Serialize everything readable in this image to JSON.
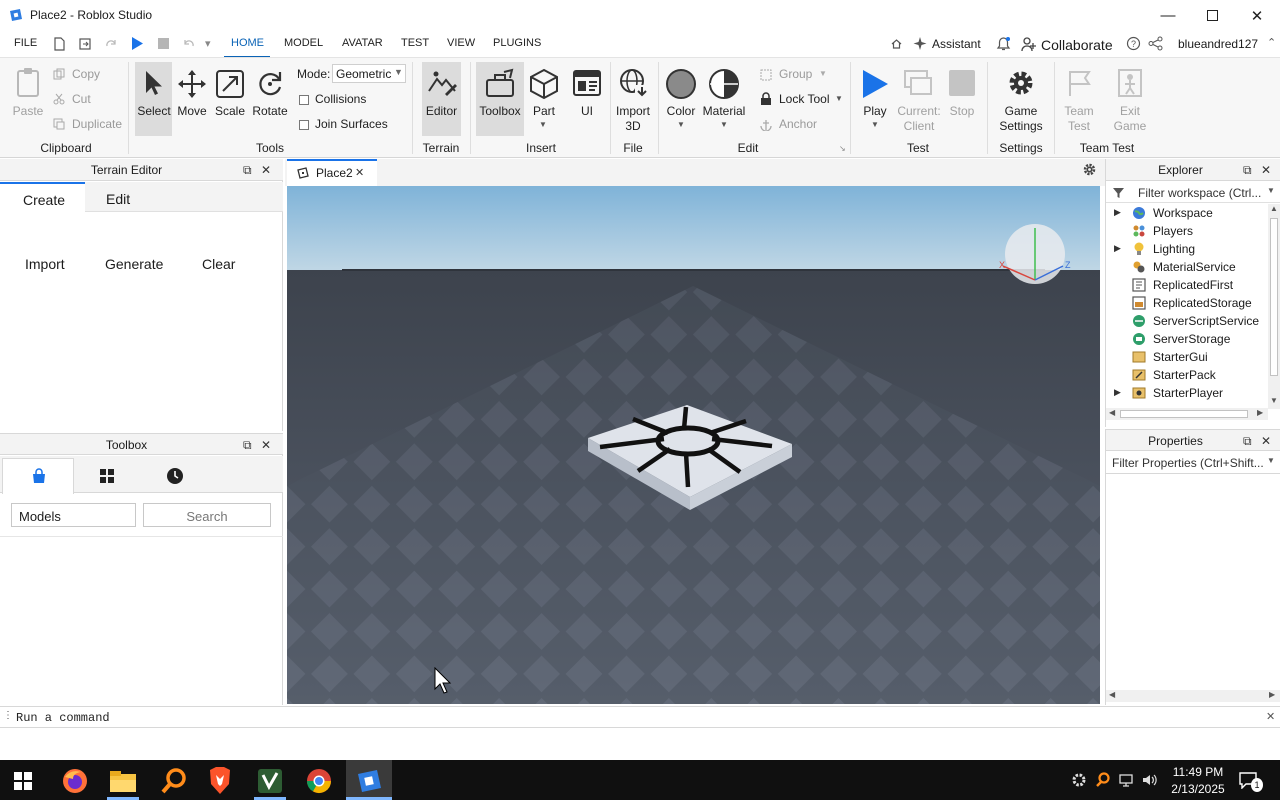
{
  "window": {
    "title": "Place2 - Roblox Studio"
  },
  "menu": {
    "file": "FILE",
    "tabs": [
      "HOME",
      "MODEL",
      "AVATAR",
      "TEST",
      "VIEW",
      "PLUGINS"
    ],
    "assistant": "Assistant",
    "collaborate": "Collaborate",
    "username": "blueandred127"
  },
  "ribbon": {
    "clipboard": {
      "paste": "Paste",
      "copy": "Copy",
      "cut": "Cut",
      "duplicate": "Duplicate",
      "label": "Clipboard"
    },
    "tools": {
      "select": "Select",
      "move": "Move",
      "scale": "Scale",
      "rotate": "Rotate",
      "mode_label": "Mode:",
      "mode_value": "Geometric",
      "collisions": "Collisions",
      "join_surfaces": "Join Surfaces",
      "label": "Tools"
    },
    "terrain": {
      "editor": "Editor",
      "label": "Terrain"
    },
    "insert": {
      "toolbox": "Toolbox",
      "part": "Part",
      "ui": "UI",
      "label": "Insert"
    },
    "file": {
      "import_line1": "Import",
      "import_line2": "3D",
      "label": "File"
    },
    "edit": {
      "color": "Color",
      "material": "Material",
      "group": "Group",
      "lock_tool": "Lock Tool",
      "anchor": "Anchor",
      "label": "Edit"
    },
    "test": {
      "play": "Play",
      "current_line1": "Current:",
      "current_line2": "Client",
      "stop": "Stop",
      "label": "Test"
    },
    "settings": {
      "game_line1": "Game",
      "game_line2": "Settings",
      "label": "Settings"
    },
    "team_test": {
      "team_line1": "Team",
      "team_line2": "Test",
      "exit_line1": "Exit",
      "exit_line2": "Game",
      "label": "Team Test"
    }
  },
  "terrain_editor": {
    "title": "Terrain Editor",
    "tabs": {
      "create": "Create",
      "edit": "Edit"
    },
    "actions": {
      "import": "Import",
      "generate": "Generate",
      "clear": "Clear"
    }
  },
  "toolbox": {
    "title": "Toolbox",
    "category": "Models",
    "search_placeholder": "Search"
  },
  "viewport_tab": {
    "label": "Place2"
  },
  "explorer": {
    "title": "Explorer",
    "filter_placeholder": "Filter workspace (Ctrl...",
    "items": [
      "Workspace",
      "Players",
      "Lighting",
      "MaterialService",
      "ReplicatedFirst",
      "ReplicatedStorage",
      "ServerScriptService",
      "ServerStorage",
      "StarterGui",
      "StarterPack",
      "StarterPlayer"
    ]
  },
  "properties": {
    "title": "Properties",
    "filter_placeholder": "Filter Properties (Ctrl+Shift..."
  },
  "command_bar": {
    "placeholder": "Run a command"
  },
  "taskbar": {
    "time": "11:49 PM",
    "date": "2/13/2025",
    "notifications": "1"
  },
  "colors": {
    "accent": "#0a63b6",
    "play": "#1a73e8",
    "taskbar": "#101010"
  }
}
